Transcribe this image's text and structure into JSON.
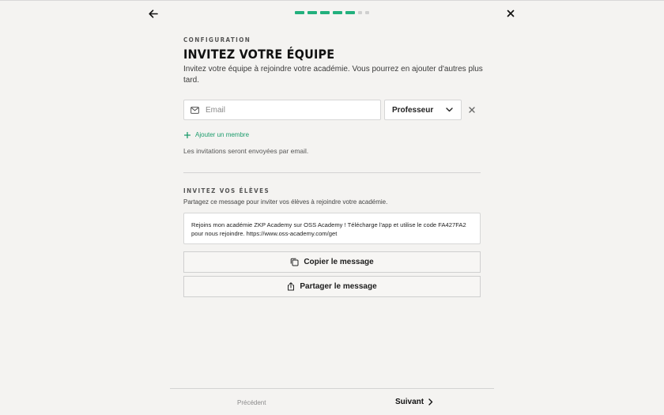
{
  "header": {
    "back_icon": "arrow-left-icon",
    "close_icon": "close-icon",
    "progress": {
      "completed_steps": 5,
      "total_steps": 7,
      "accent": "#22b07d"
    }
  },
  "section": {
    "eyebrow": "CONFIGURATION",
    "title": "INVITEZ VOTRE ÉQUIPE",
    "description": "Invitez votre équipe à rejoindre votre académie. Vous pourrez en ajouter d'autres plus tard."
  },
  "member_form": {
    "email_placeholder": "Email",
    "email_value": "",
    "role_selected": "Professeur",
    "add_member_label": "Ajouter un membre",
    "invite_note": "Les invitations seront envoyées par email."
  },
  "students": {
    "label": "INVITEZ VOS ÉLÈVES",
    "description": "Partagez ce message pour inviter vos élèves à rejoindre votre académie.",
    "message": "Rejoins mon académie ZKP Academy sur OSS Academy ! Télécharge l'app et utilise le code FA427FA2 pour nous rejoindre. https://www.oss-academy.com/get",
    "copy_label": "Copier le message",
    "share_label": "Partager le message"
  },
  "footer": {
    "prev_label": "Précédent",
    "next_label": "Suivant"
  }
}
